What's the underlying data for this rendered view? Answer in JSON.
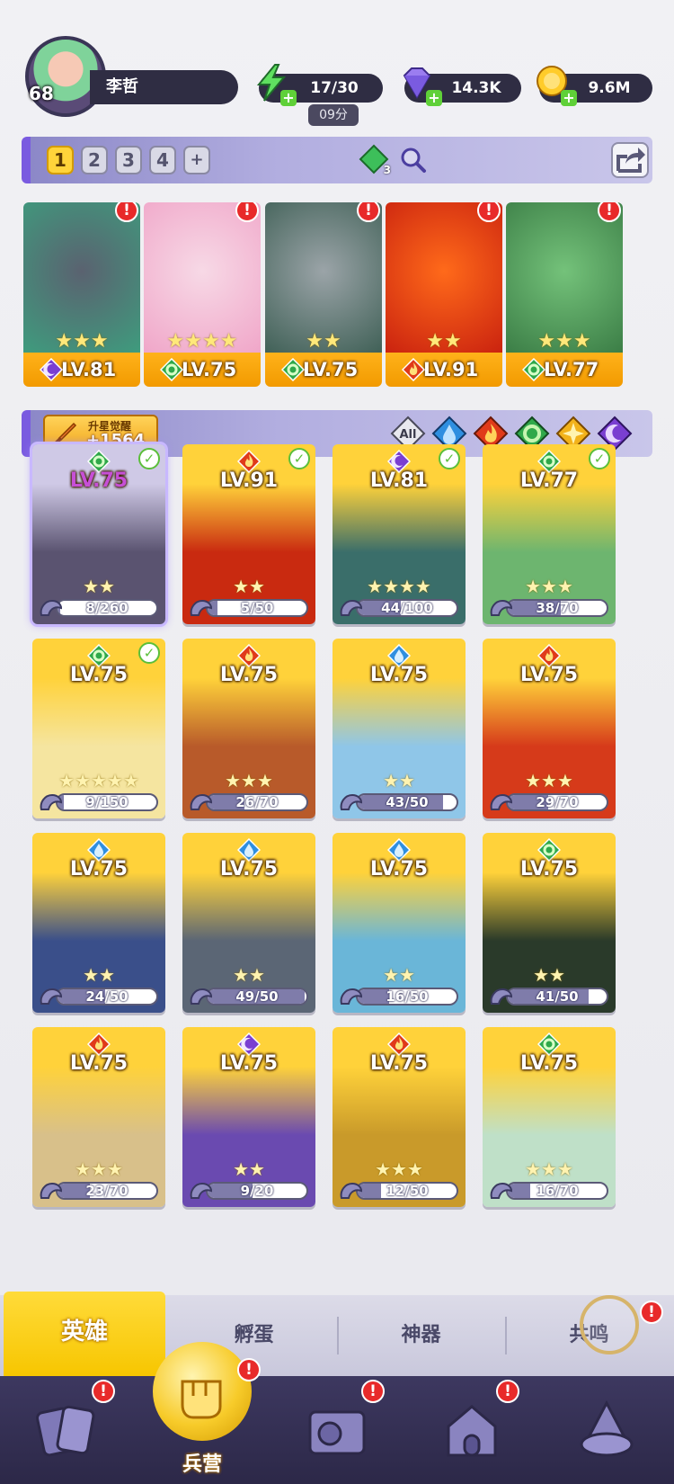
{
  "player": {
    "level": "68",
    "name": "李哲"
  },
  "resources": {
    "energy": "17/30",
    "energy_timer": "09分",
    "gems": "14.3K",
    "gold": "9.6M"
  },
  "team_bar": {
    "tabs": [
      "1",
      "2",
      "3",
      "4",
      "+"
    ],
    "active_tab": "1",
    "team_gem_count": "3"
  },
  "team": [
    {
      "level": "LV.81",
      "element": "dark",
      "stars": "★★★",
      "badge": "!",
      "colors": [
        "#5a6270",
        "#3e9d7e"
      ]
    },
    {
      "level": "LV.75",
      "element": "nature",
      "stars": "★★★★",
      "badge": "!",
      "colors": [
        "#f7d9e6",
        "#f0a5c8"
      ]
    },
    {
      "level": "LV.75",
      "element": "nature",
      "stars": "★★",
      "badge": "!",
      "colors": [
        "#9ba4a8",
        "#3e5f55"
      ]
    },
    {
      "level": "LV.91",
      "element": "fire",
      "stars": "★★",
      "badge": "!",
      "colors": [
        "#ff6a1a",
        "#c9210f"
      ]
    },
    {
      "level": "LV.77",
      "element": "nature",
      "stars": "★★★",
      "badge": "!",
      "colors": [
        "#74c27a",
        "#3a7c45"
      ]
    }
  ],
  "filter_bar": {
    "awaken_label": "升星觉醒",
    "awaken_value": "+1564",
    "filter_all": "All"
  },
  "heroes": [
    {
      "level": "LV.75",
      "element": "nature",
      "stars": "★★",
      "progress": "8/260",
      "fraction": 0.03,
      "checked": true,
      "colors": [
        "#cfc9e6",
        "#5a5370"
      ],
      "level_color": "#c64fd6"
    },
    {
      "level": "LV.91",
      "element": "fire",
      "stars": "★★",
      "progress": "5/50",
      "fraction": 0.1,
      "checked": true,
      "colors": [
        "#ffd23a",
        "#c92a10"
      ]
    },
    {
      "level": "LV.81",
      "element": "dark",
      "stars": "★★★★",
      "progress": "44/100",
      "fraction": 0.44,
      "checked": true,
      "colors": [
        "#ffd23a",
        "#3a6e6a"
      ]
    },
    {
      "level": "LV.77",
      "element": "nature",
      "stars": "★★★",
      "progress": "38/70",
      "fraction": 0.54,
      "checked": true,
      "colors": [
        "#ffd23a",
        "#6db56f"
      ]
    },
    {
      "level": "LV.75",
      "element": "nature",
      "stars": "★★★★★",
      "progress": "9/150",
      "fraction": 0.06,
      "checked": true,
      "colors": [
        "#ffd23a",
        "#f5e5a0"
      ]
    },
    {
      "level": "LV.75",
      "element": "fire",
      "stars": "★★★",
      "progress": "26/70",
      "fraction": 0.37,
      "checked": false,
      "colors": [
        "#ffd23a",
        "#b85a2a"
      ]
    },
    {
      "level": "LV.75",
      "element": "water",
      "stars": "★★",
      "progress": "43/50",
      "fraction": 0.86,
      "checked": false,
      "colors": [
        "#ffd23a",
        "#8fc6e8"
      ]
    },
    {
      "level": "LV.75",
      "element": "fire",
      "stars": "★★★",
      "progress": "29/70",
      "fraction": 0.41,
      "checked": false,
      "colors": [
        "#ffd23a",
        "#d63a1a"
      ]
    },
    {
      "level": "LV.75",
      "element": "water",
      "stars": "★★",
      "progress": "24/50",
      "fraction": 0.48,
      "checked": false,
      "colors": [
        "#ffd23a",
        "#3a4f8a"
      ]
    },
    {
      "level": "LV.75",
      "element": "water",
      "stars": "★★",
      "progress": "49/50",
      "fraction": 0.98,
      "checked": false,
      "colors": [
        "#ffd23a",
        "#5b6675"
      ]
    },
    {
      "level": "LV.75",
      "element": "water",
      "stars": "★★",
      "progress": "16/50",
      "fraction": 0.32,
      "checked": false,
      "colors": [
        "#ffd23a",
        "#6ab6d8"
      ]
    },
    {
      "level": "LV.75",
      "element": "nature",
      "stars": "★★",
      "progress": "41/50",
      "fraction": 0.82,
      "checked": false,
      "colors": [
        "#ffd23a",
        "#2a3a2a"
      ]
    },
    {
      "level": "LV.75",
      "element": "fire",
      "stars": "★★★",
      "progress": "23/70",
      "fraction": 0.33,
      "checked": false,
      "colors": [
        "#ffd23a",
        "#d8c08a"
      ]
    },
    {
      "level": "LV.75",
      "element": "dark",
      "stars": "★★",
      "progress": "9/20",
      "fraction": 0.45,
      "checked": false,
      "colors": [
        "#ffd23a",
        "#6a4ab0"
      ]
    },
    {
      "level": "LV.75",
      "element": "fire",
      "stars": "★★★",
      "progress": "12/50",
      "fraction": 0.24,
      "checked": false,
      "colors": [
        "#ffd23a",
        "#c99a2a"
      ]
    },
    {
      "level": "LV.75",
      "element": "nature",
      "stars": "★★★",
      "progress": "16/70",
      "fraction": 0.23,
      "checked": false,
      "colors": [
        "#ffd23a",
        "#bfe0c8"
      ]
    }
  ],
  "subtabs": [
    "英雄",
    "孵蛋",
    "神器",
    "共鸣"
  ],
  "nav": {
    "active_label": "兵营"
  },
  "element_colors": {
    "dark": "#7a3fd1",
    "nature": "#2fa84a",
    "fire": "#e03a1a",
    "water": "#2f8fe0",
    "light": "#f2b21a"
  }
}
